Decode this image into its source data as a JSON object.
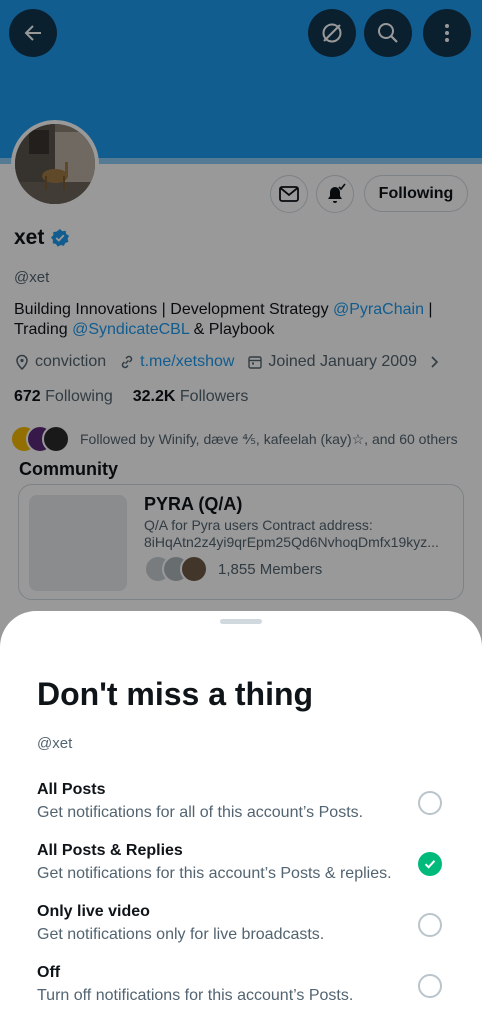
{
  "profile": {
    "name": "xet",
    "handle": "@xet",
    "following_button": "Following",
    "bio": {
      "part1": "Building Innovations | Development Strategy ",
      "mention1": "@PyraChain",
      "part2": " | Trading ",
      "mention2": "@SyndicateCBL",
      "part3": " & Playbook"
    },
    "location": "conviction",
    "website": "t.me/xetshow",
    "joined": "Joined January 2009",
    "following_count": "672",
    "following_label": "Following",
    "followers_count": "32.2K",
    "followers_label": "Followers",
    "followed_by": "Followed by Winify, dæve ⅘, kafeelah (kay)☆, and 60 others"
  },
  "community": {
    "section_title": "Community",
    "name": "PYRA (Q/A)",
    "desc_line1": "Q/A for Pyra users Contract address:",
    "desc_line2": "8iHqAtn2z4yi9qrEpm25Qd6NvhoqDmfx19kyz...",
    "members": "1,855 Members"
  },
  "sheet": {
    "title": "Don't miss a thing",
    "handle": "@xet",
    "options": [
      {
        "title": "All Posts",
        "desc": "Get notifications for all of this account’s Posts.",
        "selected": false
      },
      {
        "title": "All Posts & Replies",
        "desc": "Get notifications for this account’s Posts & replies.",
        "selected": true
      },
      {
        "title": "Only live video",
        "desc": "Get notifications only for live broadcasts.",
        "selected": false
      },
      {
        "title": "Off",
        "desc": "Turn off notifications for this account’s Posts.",
        "selected": false
      }
    ]
  },
  "colors": {
    "accent": "#1d9bf0",
    "selected": "#00ba7c"
  }
}
